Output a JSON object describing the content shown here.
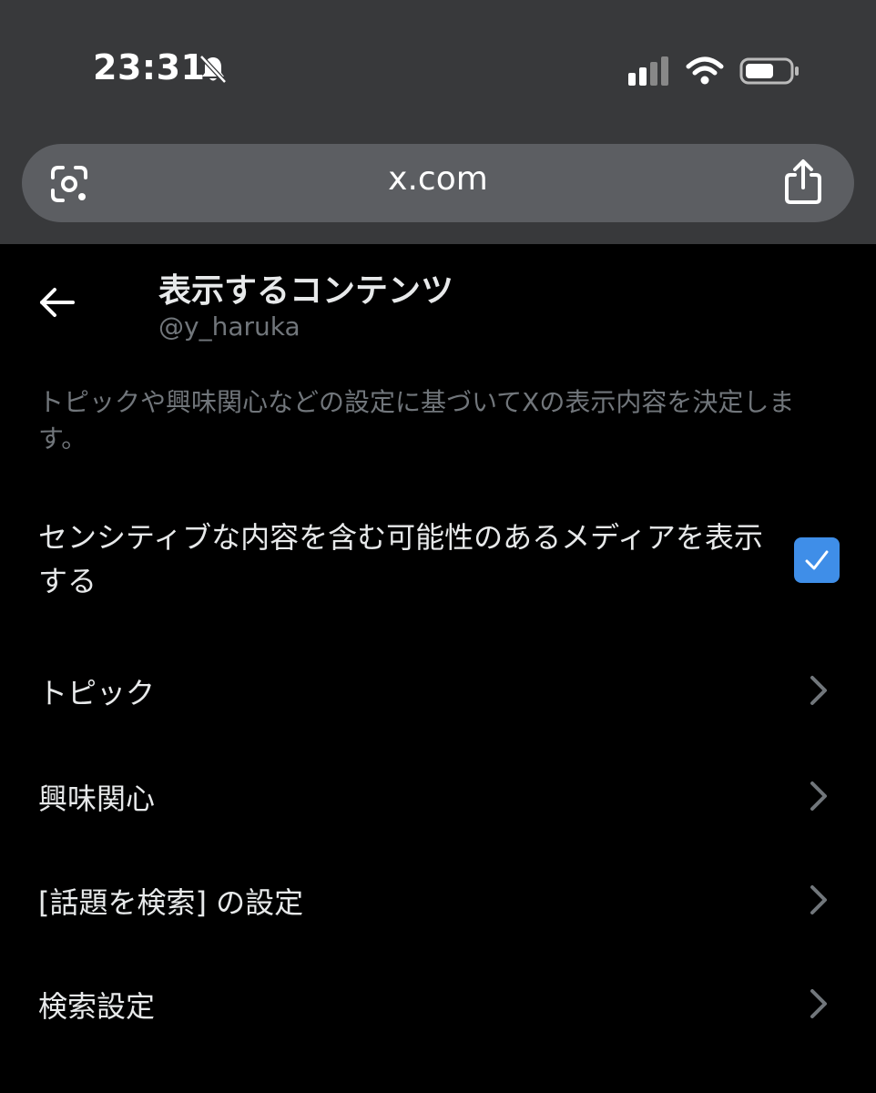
{
  "status_bar": {
    "time": "23:31"
  },
  "browser": {
    "url": "x.com"
  },
  "header": {
    "title": "表示するコンテンツ",
    "handle": "@y_haruka"
  },
  "description": "トピックや興味関心などの設定に基づいてXの表示内容を決定します。",
  "sensitive_media": {
    "label": "センシティブな内容を含む可能性のあるメディアを表示する",
    "checked": true
  },
  "menu": [
    {
      "label": "トピック",
      "icon": "chevron-right-icon"
    },
    {
      "label": "興味関心",
      "icon": "chevron-right-icon"
    },
    {
      "label": "[話題を検索] の設定",
      "icon": "chevron-right-icon"
    },
    {
      "label": "検索設定",
      "icon": "chevron-right-icon"
    }
  ],
  "colors": {
    "accent": "#3f8ee8",
    "browser_chrome": "#38393b",
    "url_bar": "#5c5e62",
    "muted_text": "#71767b"
  }
}
